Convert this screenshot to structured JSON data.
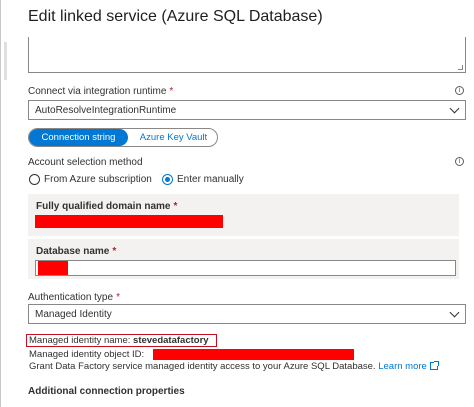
{
  "dialog": {
    "title": "Edit linked service (Azure SQL Database)"
  },
  "runtime": {
    "label": "Connect via integration runtime",
    "required_mark": "*",
    "value": "AutoResolveIntegrationRuntime"
  },
  "connection_tabs": [
    {
      "label": "Connection string",
      "selected": true
    },
    {
      "label": "Azure Key Vault",
      "selected": false
    }
  ],
  "account_selection": {
    "label": "Account selection method",
    "options": [
      {
        "label": "From Azure subscription",
        "checked": false
      },
      {
        "label": "Enter manually",
        "checked": true
      }
    ]
  },
  "fqdn": {
    "label": "Fully qualified domain name",
    "required_mark": "*"
  },
  "database": {
    "label": "Database name",
    "required_mark": "*"
  },
  "authentication": {
    "label": "Authentication type",
    "required_mark": "*",
    "value": "Managed Identity"
  },
  "managed_identity": {
    "name_label": "Managed identity name:",
    "name_value": "stevedatafactory",
    "object_id_label": "Managed identity object ID:",
    "grant_text": "Grant Data Factory service managed identity access to your Azure SQL Database.",
    "learn_more": "Learn more"
  },
  "additional": {
    "title": "Additional connection properties"
  },
  "icons": {
    "info": "info-icon",
    "chevron": "chevron-down-icon",
    "external": "external-link-icon"
  },
  "colors": {
    "accent": "#0078d4",
    "redaction": "#ff0000",
    "highlight": "#c50f1f"
  }
}
